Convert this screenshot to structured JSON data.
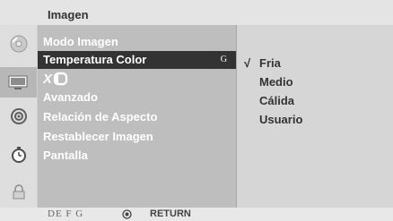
{
  "menu": {
    "title": "Imagen",
    "sidebar_icons": [
      {
        "name": "settings-disc-icon",
        "active": false
      },
      {
        "name": "screen-icon",
        "active": true
      },
      {
        "name": "sound-icon",
        "active": false
      },
      {
        "name": "time-icon",
        "active": false
      },
      {
        "name": "lock-icon",
        "active": false
      }
    ],
    "items": [
      {
        "label": "Modo Imagen"
      },
      {
        "label": "Temperatura Color",
        "selected": true,
        "hint": "G"
      },
      {
        "label": "XD",
        "is_logo": true
      },
      {
        "label": "Avanzado"
      },
      {
        "label": "Relación de Aspecto"
      },
      {
        "label": "Restablecer Imagen"
      },
      {
        "label": "Pantalla"
      }
    ],
    "options": [
      {
        "label": "Fria",
        "checked": true
      },
      {
        "label": "Medio"
      },
      {
        "label": "Cálida"
      },
      {
        "label": "Usuario"
      }
    ],
    "check_mark": "√",
    "footer": {
      "nav_keys": "DE  F G",
      "return_label": "RETURN"
    }
  }
}
